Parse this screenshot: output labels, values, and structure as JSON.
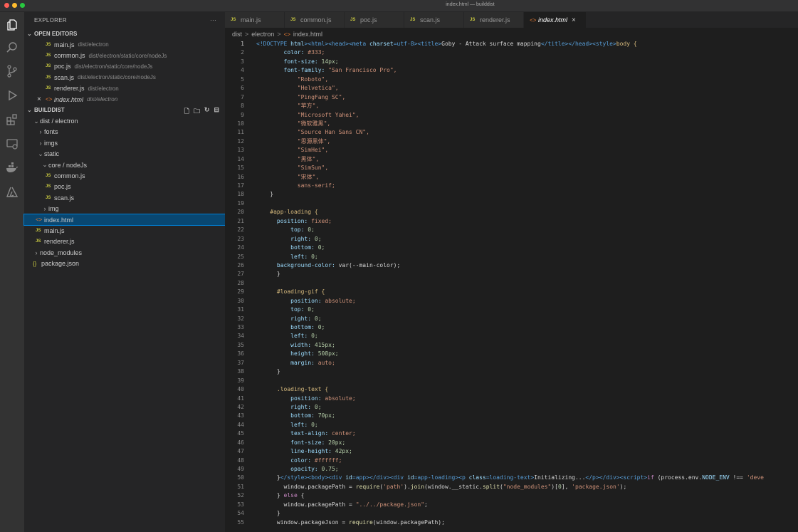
{
  "window": {
    "title": "index.html — builddist"
  },
  "sidebar": {
    "title": "EXPLORER",
    "more": "···",
    "open_editors_label": "OPEN EDITORS",
    "open_editors": [
      {
        "badge": "JS",
        "name": "main.js",
        "hint": "dist/electron"
      },
      {
        "badge": "JS",
        "name": "common.js",
        "hint": "dist/electron/static/core/nodeJs"
      },
      {
        "badge": "JS",
        "name": "poc.js",
        "hint": "dist/electron/static/core/nodeJs"
      },
      {
        "badge": "JS",
        "name": "scan.js",
        "hint": "dist/electron/static/core/nodeJs"
      },
      {
        "badge": "JS",
        "name": "renderer.js",
        "hint": "dist/electron"
      },
      {
        "badge": "<>",
        "name": "index.html",
        "hint": "dist/electron",
        "close": "×"
      }
    ],
    "project_label": "BUILDDIST",
    "tree": {
      "dist": "dist / electron",
      "fonts": "fonts",
      "imgs": "imgs",
      "static": "static",
      "core": "core / nodeJs",
      "common": "common.js",
      "poc": "poc.js",
      "scan": "scan.js",
      "img": "img",
      "index": "index.html",
      "main": "main.js",
      "renderer": "renderer.js",
      "node_modules": "node_modules",
      "package": "package.json",
      "js_badge": "JS",
      "html_badge": "<>",
      "json_badge": "{}"
    }
  },
  "tabs": [
    {
      "badge": "JS",
      "label": "main.js"
    },
    {
      "badge": "JS",
      "label": "common.js"
    },
    {
      "badge": "JS",
      "label": "poc.js"
    },
    {
      "badge": "JS",
      "label": "scan.js"
    },
    {
      "badge": "JS",
      "label": "renderer.js"
    },
    {
      "badge": "<>",
      "label": "index.html",
      "close": "×"
    }
  ],
  "breadcrumb": {
    "dist": "dist",
    "electron": "electron",
    "file": "index.html",
    "sep": ">"
  },
  "colors": {
    "tag": "#569cd6",
    "attr": "#9cdcfe",
    "string": "#ce9178",
    "text": "#d4d4d4",
    "selector": "#d7ba7d",
    "number": "#b5cea8",
    "keyword": "#c586c0",
    "func": "#dcdcaa"
  },
  "editor": {
    "lines": [
      {
        "n": "1",
        "seg": [
          [
            "<!DOCTYPE ",
            "tag"
          ],
          [
            "html",
            "attr"
          ],
          [
            ">",
            "tag"
          ],
          [
            "<html><head><meta ",
            "tag"
          ],
          [
            "charset",
            "attr"
          ],
          [
            "=utf-8>",
            "tag"
          ],
          [
            "<title>",
            "tag"
          ],
          [
            "Goby - Attack surface mapping",
            "text"
          ],
          [
            "</title></head><style>",
            "tag"
          ],
          [
            "body {",
            "selector"
          ]
        ]
      },
      {
        "n": "2",
        "seg": [
          [
            "        color: ",
            "attr"
          ],
          [
            "#333;",
            "string"
          ]
        ]
      },
      {
        "n": "3",
        "seg": [
          [
            "        font-size: ",
            "attr"
          ],
          [
            "14px;",
            "number"
          ]
        ]
      },
      {
        "n": "4",
        "seg": [
          [
            "        font-family: ",
            "attr"
          ],
          [
            "\"San Francisco Pro\",",
            "string"
          ]
        ]
      },
      {
        "n": "5",
        "seg": [
          [
            "            \"Roboto\",",
            "string"
          ]
        ]
      },
      {
        "n": "6",
        "seg": [
          [
            "            \"Helvetica\",",
            "string"
          ]
        ]
      },
      {
        "n": "7",
        "seg": [
          [
            "            \"PingFang SC\",",
            "string"
          ]
        ]
      },
      {
        "n": "8",
        "seg": [
          [
            "            \"苹方\",",
            "string"
          ]
        ]
      },
      {
        "n": "9",
        "seg": [
          [
            "            \"Microsoft Yahei\",",
            "string"
          ]
        ]
      },
      {
        "n": "10",
        "seg": [
          [
            "            \"微软雅黑\",",
            "string"
          ]
        ]
      },
      {
        "n": "11",
        "seg": [
          [
            "            \"Source Han Sans CN\",",
            "string"
          ]
        ]
      },
      {
        "n": "12",
        "seg": [
          [
            "            \"思源黑体\",",
            "string"
          ]
        ]
      },
      {
        "n": "13",
        "seg": [
          [
            "            \"SimHei\",",
            "string"
          ]
        ]
      },
      {
        "n": "14",
        "seg": [
          [
            "            \"黑体\",",
            "string"
          ]
        ]
      },
      {
        "n": "15",
        "seg": [
          [
            "            \"SimSun\",",
            "string"
          ]
        ]
      },
      {
        "n": "16",
        "seg": [
          [
            "            \"宋体\",",
            "string"
          ]
        ]
      },
      {
        "n": "17",
        "seg": [
          [
            "            sans-serif;",
            "string"
          ]
        ]
      },
      {
        "n": "18",
        "seg": [
          [
            "    }",
            "text"
          ]
        ]
      },
      {
        "n": "19",
        "seg": [
          [
            "",
            "text"
          ]
        ]
      },
      {
        "n": "20",
        "seg": [
          [
            "    #app-loading {",
            "selector"
          ]
        ]
      },
      {
        "n": "21",
        "seg": [
          [
            "      position: ",
            "attr"
          ],
          [
            "fixed;",
            "string"
          ]
        ]
      },
      {
        "n": "22",
        "seg": [
          [
            "          top: ",
            "attr"
          ],
          [
            "0;",
            "number"
          ]
        ]
      },
      {
        "n": "23",
        "seg": [
          [
            "          right: ",
            "attr"
          ],
          [
            "0;",
            "number"
          ]
        ]
      },
      {
        "n": "24",
        "seg": [
          [
            "          bottom: ",
            "attr"
          ],
          [
            "0;",
            "number"
          ]
        ]
      },
      {
        "n": "25",
        "seg": [
          [
            "          left: ",
            "attr"
          ],
          [
            "0;",
            "number"
          ]
        ]
      },
      {
        "n": "26",
        "seg": [
          [
            "      background-color: ",
            "attr"
          ],
          [
            "var(--main-color);",
            "text"
          ]
        ]
      },
      {
        "n": "27",
        "seg": [
          [
            "      }",
            "text"
          ]
        ]
      },
      {
        "n": "28",
        "seg": [
          [
            "",
            "text"
          ]
        ]
      },
      {
        "n": "29",
        "seg": [
          [
            "      #loading-gif {",
            "selector"
          ]
        ]
      },
      {
        "n": "30",
        "seg": [
          [
            "          position: ",
            "attr"
          ],
          [
            "absolute;",
            "string"
          ]
        ]
      },
      {
        "n": "31",
        "seg": [
          [
            "          top: ",
            "attr"
          ],
          [
            "0;",
            "number"
          ]
        ]
      },
      {
        "n": "32",
        "seg": [
          [
            "          right: ",
            "attr"
          ],
          [
            "0;",
            "number"
          ]
        ]
      },
      {
        "n": "33",
        "seg": [
          [
            "          bottom: ",
            "attr"
          ],
          [
            "0;",
            "number"
          ]
        ]
      },
      {
        "n": "34",
        "seg": [
          [
            "          left: ",
            "attr"
          ],
          [
            "0;",
            "number"
          ]
        ]
      },
      {
        "n": "35",
        "seg": [
          [
            "          width: ",
            "attr"
          ],
          [
            "415px;",
            "number"
          ]
        ]
      },
      {
        "n": "36",
        "seg": [
          [
            "          height: ",
            "attr"
          ],
          [
            "508px;",
            "number"
          ]
        ]
      },
      {
        "n": "37",
        "seg": [
          [
            "          margin: ",
            "attr"
          ],
          [
            "auto;",
            "string"
          ]
        ]
      },
      {
        "n": "38",
        "seg": [
          [
            "      }",
            "text"
          ]
        ]
      },
      {
        "n": "39",
        "seg": [
          [
            "",
            "text"
          ]
        ]
      },
      {
        "n": "40",
        "seg": [
          [
            "      .loading-text {",
            "selector"
          ]
        ]
      },
      {
        "n": "41",
        "seg": [
          [
            "          position: ",
            "attr"
          ],
          [
            "absolute;",
            "string"
          ]
        ]
      },
      {
        "n": "42",
        "seg": [
          [
            "          right: ",
            "attr"
          ],
          [
            "0;",
            "number"
          ]
        ]
      },
      {
        "n": "43",
        "seg": [
          [
            "          bottom: ",
            "attr"
          ],
          [
            "70px;",
            "number"
          ]
        ]
      },
      {
        "n": "44",
        "seg": [
          [
            "          left: ",
            "attr"
          ],
          [
            "0;",
            "number"
          ]
        ]
      },
      {
        "n": "45",
        "seg": [
          [
            "          text-align: ",
            "attr"
          ],
          [
            "center;",
            "string"
          ]
        ]
      },
      {
        "n": "46",
        "seg": [
          [
            "          font-size: ",
            "attr"
          ],
          [
            "20px;",
            "number"
          ]
        ]
      },
      {
        "n": "47",
        "seg": [
          [
            "          line-height: ",
            "attr"
          ],
          [
            "42px;",
            "number"
          ]
        ]
      },
      {
        "n": "48",
        "seg": [
          [
            "          color: ",
            "attr"
          ],
          [
            "#ffffff;",
            "string"
          ]
        ]
      },
      {
        "n": "49",
        "seg": [
          [
            "          opacity: ",
            "attr"
          ],
          [
            "0.75;",
            "number"
          ]
        ]
      },
      {
        "n": "50",
        "seg": [
          [
            "      }",
            "text"
          ],
          [
            "</style><body><div ",
            "tag"
          ],
          [
            "id",
            "attr"
          ],
          [
            "=app></div><div ",
            "tag"
          ],
          [
            "id",
            "attr"
          ],
          [
            "=app-loading><p ",
            "tag"
          ],
          [
            "class",
            "attr"
          ],
          [
            "=loading-text>",
            "tag"
          ],
          [
            "Initializing...",
            "text"
          ],
          [
            "</p></div><script>",
            "tag"
          ],
          [
            "if ",
            "keyword"
          ],
          [
            "(process.env.",
            "text"
          ],
          [
            "NODE_ENV",
            "attr"
          ],
          [
            " !== ",
            "text"
          ],
          [
            "'deve",
            "string"
          ]
        ]
      },
      {
        "n": "51",
        "seg": [
          [
            "        window.packagePath = ",
            "text"
          ],
          [
            "require",
            "func"
          ],
          [
            "(",
            "text"
          ],
          [
            "'path'",
            "string"
          ],
          [
            ").",
            "text"
          ],
          [
            "join",
            "func"
          ],
          [
            "(window.__static.",
            "text"
          ],
          [
            "split",
            "func"
          ],
          [
            "(",
            "text"
          ],
          [
            "\"node_modules\"",
            "string"
          ],
          [
            ")[",
            "text"
          ],
          [
            "0",
            "number"
          ],
          [
            "], ",
            "text"
          ],
          [
            "'package.json'",
            "string"
          ],
          [
            ");",
            "text"
          ]
        ]
      },
      {
        "n": "52",
        "seg": [
          [
            "      } ",
            "text"
          ],
          [
            "else ",
            "keyword"
          ],
          [
            "{",
            "text"
          ]
        ]
      },
      {
        "n": "53",
        "seg": [
          [
            "        window.packagePath = ",
            "text"
          ],
          [
            "\"../../package.json\"",
            "string"
          ],
          [
            ";",
            "text"
          ]
        ]
      },
      {
        "n": "54",
        "seg": [
          [
            "      }",
            "text"
          ]
        ]
      },
      {
        "n": "55",
        "seg": [
          [
            "      window.packageJson = ",
            "text"
          ],
          [
            "require",
            "func"
          ],
          [
            "(window.packagePath);",
            "text"
          ]
        ]
      }
    ]
  }
}
